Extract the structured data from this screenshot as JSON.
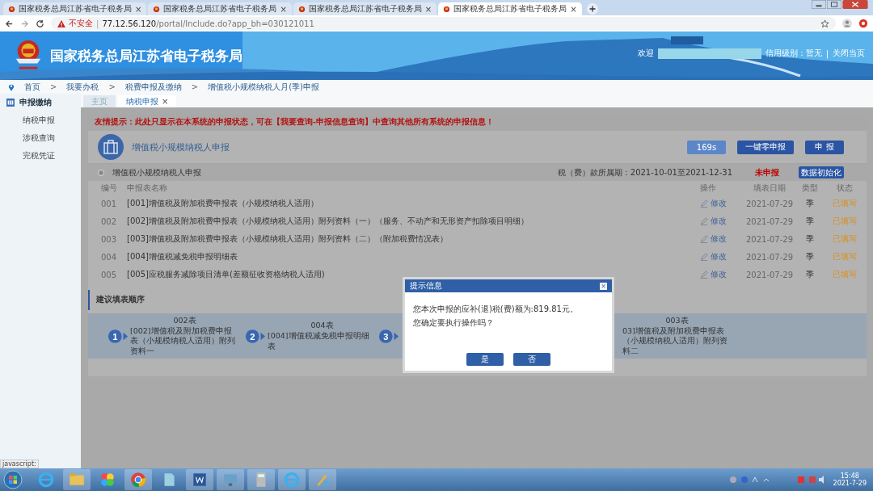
{
  "browser_tabs": [
    {
      "title": "国家税务总局江苏省电子税务局",
      "selected": false
    },
    {
      "title": "国家税务总局江苏省电子税务局",
      "selected": false
    },
    {
      "title": "国家税务总局江苏省电子税务局",
      "selected": false
    },
    {
      "title": "国家税务总局江苏省电子税务局",
      "selected": true
    }
  ],
  "address_bar": {
    "security": "不安全",
    "separator": "|",
    "url_host": "77.12.56.120",
    "url_path": "/portal/Include.do?app_bh=030121011"
  },
  "header": {
    "title": "国家税务总局江苏省电子税务局",
    "welcome": "欢迎",
    "credit": "信用级别：暂无",
    "separator": "|",
    "close": "关闭当页"
  },
  "breadcrumb": [
    "首页",
    "我要办税",
    "税费申报及缴纳",
    "增值税小规模纳税人月(季)申报"
  ],
  "breadcrumb_separator": ">",
  "sidebar": {
    "title": "申报缴纳",
    "items": [
      "纳税申报",
      "涉税查询",
      "完税凭证"
    ]
  },
  "page_tabs": [
    {
      "label": "主页",
      "selected": false,
      "closable": false
    },
    {
      "label": "纳税申报",
      "selected": true,
      "closable": true
    }
  ],
  "close_glyph": "×",
  "notice": "友情提示：此处只显示在本系统的申报状态，可在【我要查询-申报信息查询】中查询其他所有系统的申报信息！",
  "form_title": "增值税小规模纳税人申报",
  "buttons": {
    "timer": "169s",
    "zero": "一键零申报",
    "submit": "申 报",
    "init": "数据初始化"
  },
  "section": {
    "title": "增值税小规模纳税人申报",
    "period": "税（费）款所属期：2021-10-01至2021-12-31",
    "status": "未申报"
  },
  "table": {
    "columns": [
      "编号",
      "申报表名称",
      "操作",
      "填表日期",
      "类型",
      "状态"
    ],
    "rows": [
      {
        "no": "001",
        "name": "[001]增值税及附加税费申报表（小规模纳税人适用）",
        "action": "修改",
        "date": "2021-07-29",
        "type": "季",
        "status": "已填写"
      },
      {
        "no": "002",
        "name": "[002]增值税及附加税费申报表（小规模纳税人适用）附列资料（一）（服务、不动产和无形资产扣除项目明细）",
        "action": "修改",
        "date": "2021-07-29",
        "type": "季",
        "status": "已填写"
      },
      {
        "no": "003",
        "name": "[003]增值税及附加税费申报表（小规模纳税人适用）附列资料（二）（附加税费情况表）",
        "action": "修改",
        "date": "2021-07-29",
        "type": "季",
        "status": "已填写"
      },
      {
        "no": "004",
        "name": "[004]增值税减免税申报明细表",
        "action": "修改",
        "date": "2021-07-29",
        "type": "季",
        "status": "已填写"
      },
      {
        "no": "005",
        "name": "[005]应税服务减除项目清单(差额征收资格纳税人适用)",
        "action": "修改",
        "date": "2021-07-29",
        "type": "季",
        "status": "已填写"
      }
    ]
  },
  "order": {
    "title": "建议填表顺序",
    "steps": [
      {
        "number": "1",
        "table": "002表",
        "name": "[002]增值税及附加税费申报表（小规模纳税人适用）附列资料一"
      },
      {
        "number": "2",
        "table": "004表",
        "name": "[004]增值税减免税申报明细表"
      },
      {
        "number": "3"
      },
      {
        "table": "003表",
        "name": "03]增值税及附加税费申报表（小规模纳税人适用）附列资料二"
      }
    ]
  },
  "dialog": {
    "title": "提示信息",
    "message": "您本次申报的应补(退)税(费)额为:819.81元。",
    "question": "您确定要执行操作吗？",
    "yes": "是",
    "no": "否"
  },
  "status_tooltip": "javascript:",
  "clock": {
    "time": "15:48",
    "date": "2021-7-29"
  }
}
